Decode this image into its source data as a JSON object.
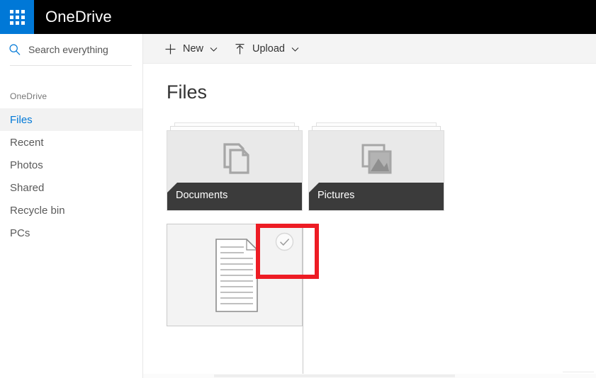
{
  "suite": {
    "app_title": "OneDrive",
    "waffle_icon": "app-launcher-waffle-icon",
    "accent_color": "#0078d7",
    "bar_color": "#000000"
  },
  "search": {
    "placeholder": "Search everything",
    "value": "",
    "icon": "search-magnifier-icon"
  },
  "sidebar": {
    "section_label": "OneDrive",
    "items": [
      {
        "label": "Files",
        "selected": true
      },
      {
        "label": "Recent",
        "selected": false
      },
      {
        "label": "Photos",
        "selected": false
      },
      {
        "label": "Shared",
        "selected": false
      },
      {
        "label": "Recycle bin",
        "selected": false
      },
      {
        "label": "PCs",
        "selected": false
      }
    ],
    "selected_color": "#0078d7"
  },
  "toolbar": {
    "new_label": "New",
    "new_icon": "plus-icon",
    "new_chevron": "chevron-down-icon",
    "upload_label": "Upload",
    "upload_icon": "upload-arrow-icon",
    "upload_chevron": "chevron-down-icon"
  },
  "main": {
    "page_title": "Files",
    "tiles": [
      {
        "name": "Documents",
        "type": "folder",
        "icon": "documents-stack-icon",
        "selected": false
      },
      {
        "name": "Pictures",
        "type": "folder",
        "icon": "pictures-photo-stack-icon",
        "selected": false
      },
      {
        "name": "",
        "type": "file",
        "icon": "document-page-icon",
        "check_icon": "check-circle-icon",
        "selected": false
      }
    ]
  },
  "annotation": {
    "color": "#ed1c24",
    "target": "check-circle-icon"
  }
}
